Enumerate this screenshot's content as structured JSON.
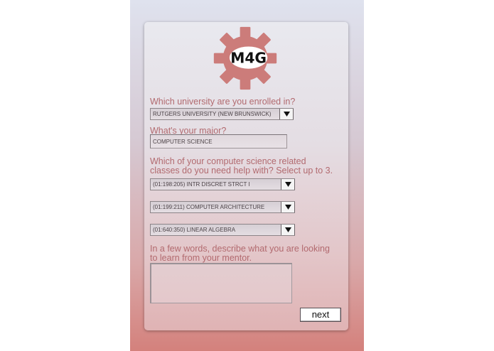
{
  "logo": {
    "text": "M4G",
    "gear_color": "#cc7c7a"
  },
  "form": {
    "university": {
      "question": "Which university are you enrolled in?",
      "selected": "RUTGERS UNIVERSITY (NEW BRUNSWICK)"
    },
    "major": {
      "question": "What's your major?",
      "value": "COMPUTER SCIENCE"
    },
    "classes": {
      "question_line1": "Which of your computer science related",
      "question_line2": "classes do you need help with? Select up to 3.",
      "selects": [
        {
          "selected": "(01:198:205) INTR DISCRET STRCT I"
        },
        {
          "selected": "(01:199:211) COMPUTER ARCHITECTURE"
        },
        {
          "selected": "(01:640:350) LINEAR ALGEBRA"
        }
      ]
    },
    "goals": {
      "question_line1": "In a few words, describe what you are looking",
      "question_line2": "to learn from your mentor.",
      "value": ""
    },
    "next_label": "next"
  }
}
